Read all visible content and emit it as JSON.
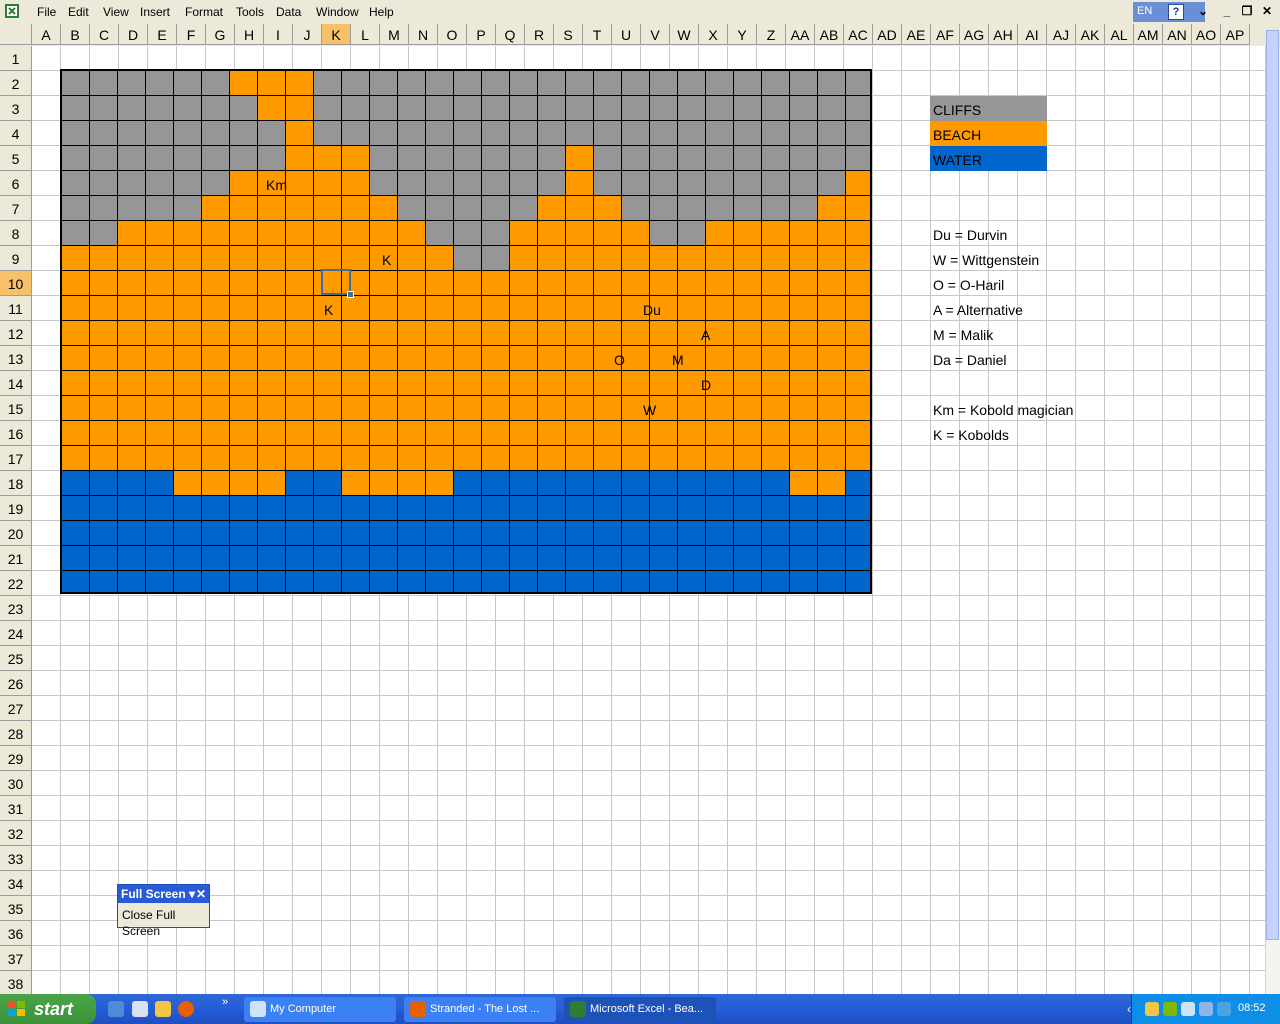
{
  "menu": [
    "File",
    "Edit",
    "View",
    "Insert",
    "Format",
    "Tools",
    "Data",
    "Window",
    "Help"
  ],
  "menubar_right": {
    "language": "EN",
    "help": "?"
  },
  "columns": [
    "A",
    "B",
    "C",
    "D",
    "E",
    "F",
    "G",
    "H",
    "I",
    "J",
    "K",
    "L",
    "M",
    "N",
    "O",
    "P",
    "Q",
    "R",
    "S",
    "T",
    "U",
    "V",
    "W",
    "X",
    "Y",
    "Z",
    "AA",
    "AB",
    "AC",
    "AD",
    "AE",
    "AF",
    "AG",
    "AH",
    "AI",
    "AJ",
    "AK",
    "AL",
    "AM",
    "AN",
    "AO",
    "AP"
  ],
  "rows": [
    "1",
    "2",
    "3",
    "4",
    "5",
    "6",
    "7",
    "8",
    "9",
    "10",
    "11",
    "12",
    "13",
    "14",
    "15",
    "16",
    "17",
    "18",
    "19",
    "20",
    "21",
    "22",
    "23",
    "24",
    "25",
    "26",
    "27",
    "28",
    "29",
    "30",
    "31",
    "32",
    "33",
    "34",
    "35",
    "36",
    "37",
    "38"
  ],
  "selected_cell": {
    "column": "K",
    "row": "10"
  },
  "terrain_colors": {
    "C": "#969696",
    "B": "#ff9900",
    "W": "#0066cc"
  },
  "map": {
    "grid": [
      "GGGGGGBBBGGGGGGGGGGGGGGGGGGGG",
      "GGGGGGGBBGGGGGGGGGGGGGGGGGGGG",
      "GGGGGGGGBGGGGGGGGGGGGGGGGGGGG",
      "GGGGGGGGBBBGGGGGGGBGGGGGGGGGG",
      "GGGGGGBBBBBGGGGGGGBGGGGGGGGGB",
      "GGGGGBBBBBBBGGGGGBBBGGGGGGGBB",
      "GGBBBBBBBBBBBGGGBBBBBGGBBBBBB",
      "BBBBBBBBBBBBBBGGBBBBBBBBBBBBB",
      "BBBBBBBBBBBBBBBBBBBBBBBBBBBBB",
      "BBBBBBBBBBBBBBBBBBBBBBBBBBBBB",
      "BBBBBBBBBBBBBBBBBBBBBBBBBBBBB",
      "BBBBBBBBBBBBBBBBBBBBBBBBBBBBB",
      "BBBBBBBBBBBBBBBBBBBBBBBBBBBBB",
      "BBBBBBBBBBBBBBBBBBBBBBBBBBBBB",
      "BBBBBBBBBBBBBBBBBBBBBBBBBBBBB",
      "BBBBBBBBBBBBBBBBBBBBBBBBBBBBB",
      "WWWWBBBBWWBBBBWWWWWWWWWWWWBBW",
      "WWWWWWWWWWWWWWWWWWWWWWWWWWWWW",
      "WWWWWWWWWWWWWWWWWWWWWWWWWWWWW",
      "WWWWWWWWWWWWWWWWWWWWWWWWWWWWW",
      "WWWWWWWWWWWWWWWWWWWWWWWWWWWWW"
    ],
    "labels": [
      {
        "text": "Km",
        "cell": "I6"
      },
      {
        "text": "K",
        "cell": "M9"
      },
      {
        "text": "K",
        "cell": "K11"
      },
      {
        "text": "Du",
        "cell": "V11"
      },
      {
        "text": "A",
        "cell": "X12"
      },
      {
        "text": "O",
        "cell": "U13"
      },
      {
        "text": "M",
        "cell": "W13"
      },
      {
        "text": "D",
        "cell": "X14"
      },
      {
        "text": "W",
        "cell": "V15"
      }
    ]
  },
  "legend": {
    "terrain": [
      {
        "label": "CLIFFS",
        "color": "#969696"
      },
      {
        "label": "BEACH",
        "color": "#ff9900"
      },
      {
        "label": "WATER",
        "color": "#0066cc"
      }
    ],
    "keys": [
      "Du = Durvin",
      "W = Wittgenstein",
      "O = O-Haril",
      "A = Alternative",
      "M = Malik",
      "Da = Daniel",
      "",
      "Km = Kobold magician",
      "K = Kobolds"
    ]
  },
  "fullscreen_toolbar": {
    "title": "Full Screen",
    "close_label": "Close Full Screen"
  },
  "taskbar": {
    "start_label": "start",
    "quicklaunch": [
      "ie-icon",
      "doc-icon",
      "outlook-icon",
      "firefox-icon"
    ],
    "tasks": [
      {
        "label": "My Computer",
        "icon": "computer-icon",
        "active": false
      },
      {
        "label": "Stranded - The Lost ...",
        "icon": "firefox-icon",
        "active": false
      },
      {
        "label": "Microsoft Excel - Bea...",
        "icon": "excel-icon",
        "active": true
      }
    ],
    "clock": "08:52"
  }
}
